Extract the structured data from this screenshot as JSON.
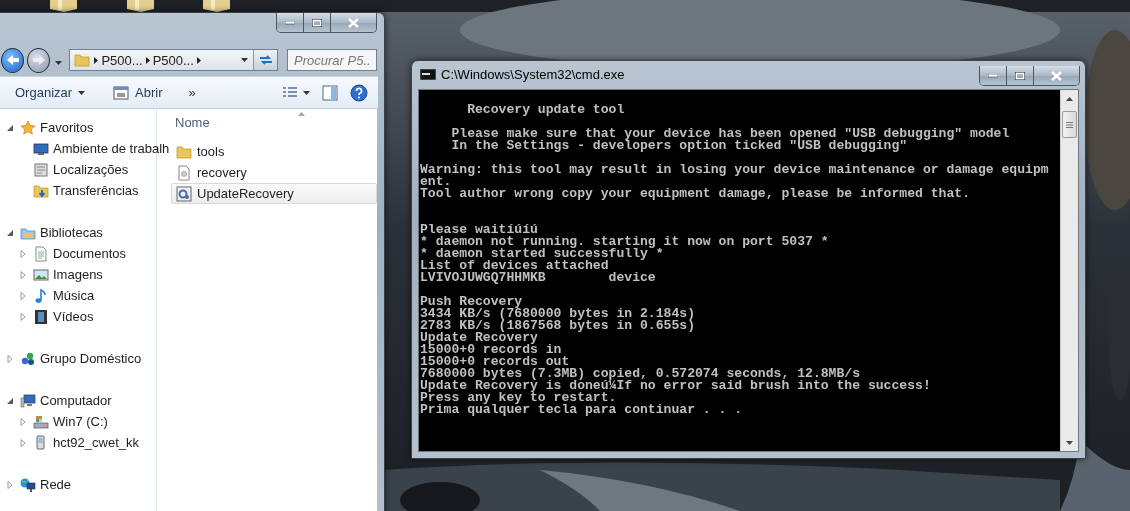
{
  "explorer": {
    "address_bar": {
      "crumbs": [
        "P500...",
        "P500..."
      ]
    },
    "search": {
      "placeholder": "Procurar P5..."
    },
    "toolbar": {
      "organize": "Organizar",
      "open": "Abrir",
      "more": "»"
    },
    "nav_pane": {
      "sections": [
        {
          "label": "Favoritos",
          "expanded": true,
          "children": [
            {
              "label": "Ambiente de trabalh"
            },
            {
              "label": "Localizações"
            },
            {
              "label": "Transferências"
            }
          ]
        },
        {
          "label": "Bibliotecas",
          "expanded": true,
          "children": [
            {
              "label": "Documentos",
              "expanded": false
            },
            {
              "label": "Imagens",
              "expanded": false
            },
            {
              "label": "Música",
              "expanded": false
            },
            {
              "label": "Vídeos",
              "expanded": false
            }
          ]
        },
        {
          "label": "Grupo Doméstico",
          "expanded": false
        },
        {
          "label": "Computador",
          "expanded": true,
          "children": [
            {
              "label": "Win7 (C:)",
              "expanded": false
            },
            {
              "label": "hct92_cwet_kk",
              "expanded": false
            }
          ]
        },
        {
          "label": "Rede",
          "expanded": false
        }
      ]
    },
    "file_list": {
      "column": "Nome",
      "files": [
        {
          "name": "tools",
          "kind": "folder",
          "selected": false
        },
        {
          "name": "recovery",
          "kind": "file",
          "selected": false
        },
        {
          "name": "UpdateRecovery",
          "kind": "program",
          "selected": true
        }
      ]
    }
  },
  "console_window": {
    "title": "C:\\Windows\\System32\\cmd.exe",
    "paragraphs": [
      {
        "kind": "normal",
        "lines": [
          "      Recovery update tool"
        ]
      },
      {
        "kind": "normal",
        "lines": [
          "    Please make sure that your device has been opened \"USB debugging\" model",
          "    In the Settings - developers option ticked \"USB debugging\""
        ]
      },
      {
        "kind": "normal",
        "lines": [
          "Warning: this tool may result in losing your device maintenance or damage equipm",
          "ent.",
          "Tool author wrong copy your equipment damage, please be informed that."
        ]
      },
      {
        "kind": "wide_gap",
        "lines": [
          "Please waitíúíú",
          "* daemon not running. starting it now on port 5037 *",
          "* daemon started successfully *",
          "List of devices attached",
          "LVIVOJUWGQ7HHMKB        device"
        ]
      },
      {
        "kind": "normal",
        "lines": [
          "Push Recovery",
          "3434 KB/s (7680000 bytes in 2.184s)",
          "2783 KB/s (1867568 bytes in 0.655s)",
          "Update Recovery",
          "15000+0 records in",
          "15000+0 records out",
          "7680000 bytes (7.3MB) copied, 0.572074 seconds, 12.8MB/s",
          "Update Recovery is doneú¼If no error said brush into the success!",
          "Press any key to restart.",
          "Prima qualquer tecla para continuar . . ."
        ]
      }
    ]
  }
}
